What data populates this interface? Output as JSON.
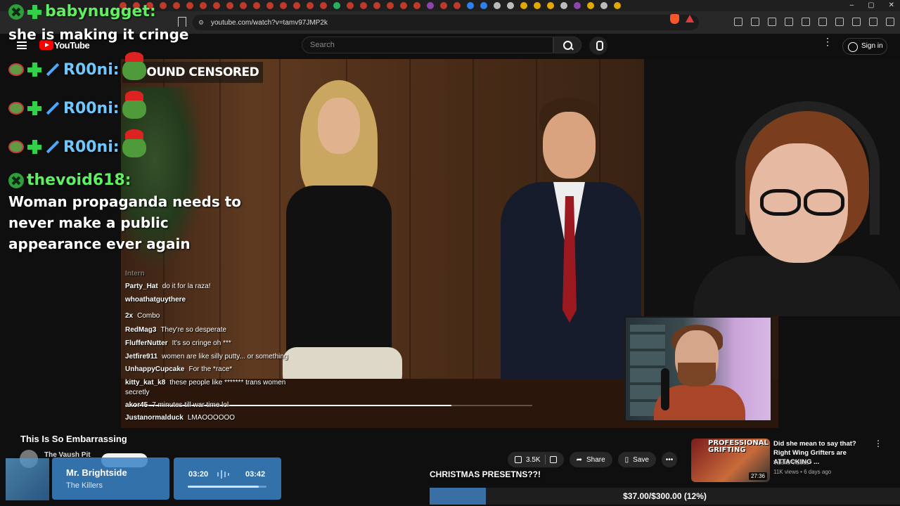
{
  "browser": {
    "url": "youtube.com/watch?v=tamv97JMP2k"
  },
  "youtube": {
    "logo_text": "YouTube",
    "search_placeholder": "Search",
    "signin_label": "Sign in"
  },
  "stream_chat": {
    "top_user": "babynugget:",
    "top_message": "she is making it cringe",
    "repeat_user": "R00ni:",
    "user2": "thevoid618:",
    "user2_message": "Woman propaganda needs to never make a public appearance ever again"
  },
  "video": {
    "censor_text": "MPOUND CENSORED",
    "progress_fraction": 0.8
  },
  "small_chat": [
    {
      "user": "Intern",
      "text": "",
      "faint": true
    },
    {
      "user": "Party_Hat",
      "text": "do it for la raza!"
    },
    {
      "user": "whoathatguythere",
      "text": ""
    },
    {
      "user": "2x",
      "text": "Combo"
    },
    {
      "user": "RedMag3",
      "text": "They're so desperate"
    },
    {
      "user": "FlufferNutter",
      "text": "It's so cringe oh ***"
    },
    {
      "user": "Jetfire911",
      "text": "women are like silly putty... or something"
    },
    {
      "user": "UnhappyCupcake",
      "text": "For the *race*"
    },
    {
      "user": "kitty_kat_k8",
      "text": "these people like ******* trans women"
    },
    {
      "user": "",
      "text": "secretly"
    },
    {
      "user": "akor45",
      "text": "7 minutes till war time lol"
    },
    {
      "user": "Justanormalduck",
      "text": "LMAOOOOOO"
    }
  ],
  "video_info": {
    "title": "This Is So Embarrassing",
    "channel": "The Vaush Pit",
    "likes": "3.5K",
    "share_label": "Share",
    "save_label": "Save"
  },
  "now_playing": {
    "song": "Mr. Brightside",
    "artist": "The Killers",
    "current_time": "03:20",
    "total_time": "03:42",
    "progress_fraction": 0.9
  },
  "donation_goal": {
    "label": "CHRISTMAS PRESETNS??!",
    "amount": "$37.00/$300.00 (12%)",
    "fraction": 0.12
  },
  "recommendation": {
    "thumb_text": "PROFESSIONAL GRIFTING",
    "duration": "27:36",
    "title": "Did she mean to say that? Right Wing Grifters are ATTACKING ...",
    "channel": "Valenti Videos",
    "meta": "11K views • 6 days ago"
  },
  "colors": {
    "chat_name_green": "#5ef05e",
    "chat_name_blue": "#6ec8ff",
    "now_playing_bg": "#3a82c7",
    "goal_fill": "#3a6fa5"
  }
}
